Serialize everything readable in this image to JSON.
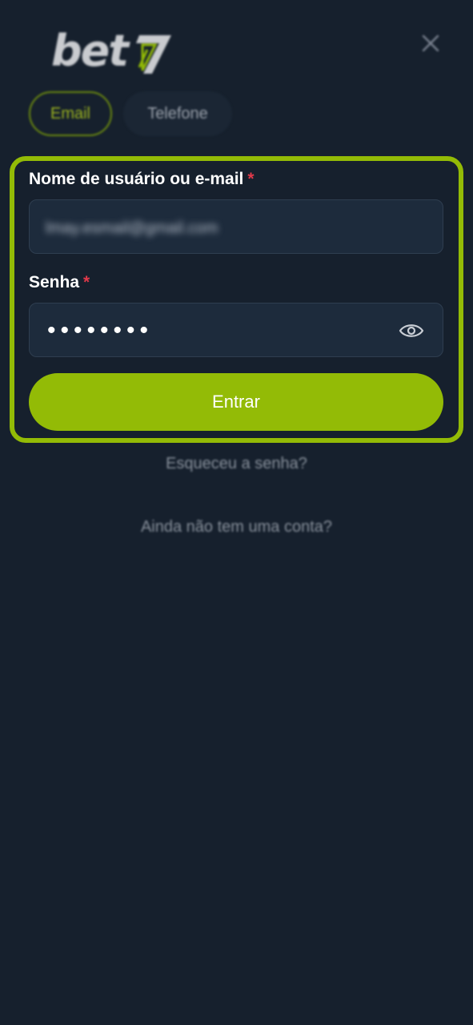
{
  "logo": {
    "brand_text": "bet",
    "brand_mark": "7",
    "accent_color": "#93bb06"
  },
  "header": {
    "close_icon": "close-icon"
  },
  "tabs": [
    {
      "label": "Email",
      "active": true
    },
    {
      "label": "Telefone",
      "active": false
    }
  ],
  "form": {
    "username": {
      "label": "Nome de usuário ou e-mail",
      "required_marker": "*",
      "value": "lmay.esmail@gmail.com"
    },
    "password": {
      "label": "Senha",
      "required_marker": "*",
      "masked_value": "••••••••",
      "toggle_icon": "eye-icon"
    },
    "submit_label": "Entrar",
    "highlight_color": "#93bb06"
  },
  "links": {
    "forgot_password": "Esqueceu a senha?",
    "no_account": "Ainda não tem uma conta?"
  }
}
